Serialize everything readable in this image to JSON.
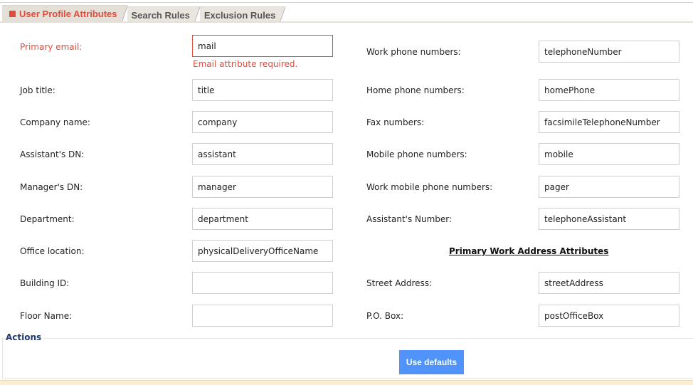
{
  "tabs": [
    {
      "label": "User Profile Attributes",
      "active": true,
      "has_error": true
    },
    {
      "label": "Search Rules",
      "active": false
    },
    {
      "label": "Exclusion Rules",
      "active": false
    }
  ],
  "left_fields": [
    {
      "label": "Primary email:",
      "value": "mail",
      "error": "Email attribute required."
    },
    {
      "label": "Job title:",
      "value": "title"
    },
    {
      "label": "Company name:",
      "value": "company"
    },
    {
      "label": "Assistant's DN:",
      "value": "assistant"
    },
    {
      "label": "Manager's DN:",
      "value": "manager"
    },
    {
      "label": "Department:",
      "value": "department"
    },
    {
      "label": "Office location:",
      "value": "physicalDeliveryOfficeName"
    },
    {
      "label": "Building ID:",
      "value": ""
    },
    {
      "label": "Floor Name:",
      "value": ""
    }
  ],
  "right_fields": [
    {
      "label": "Work phone numbers:",
      "value": "telephoneNumber"
    },
    {
      "label": "Home phone numbers:",
      "value": "homePhone"
    },
    {
      "label": "Fax numbers:",
      "value": "facsimileTelephoneNumber"
    },
    {
      "label": "Mobile phone numbers:",
      "value": "mobile"
    },
    {
      "label": "Work mobile phone numbers:",
      "value": "pager"
    },
    {
      "label": "Assistant's Number:",
      "value": "telephoneAssistant"
    }
  ],
  "address_section": {
    "heading": "Primary Work Address Attributes",
    "fields": [
      {
        "label": "Street Address:",
        "value": "streetAddress"
      },
      {
        "label": "P.O. Box:",
        "value": "postOfficeBox"
      }
    ]
  },
  "actions": {
    "legend": "Actions",
    "use_defaults_label": "Use defaults"
  },
  "colors": {
    "error": "#e24b3b",
    "primary_button": "#4f93fb",
    "legend": "#1e3a6e"
  }
}
